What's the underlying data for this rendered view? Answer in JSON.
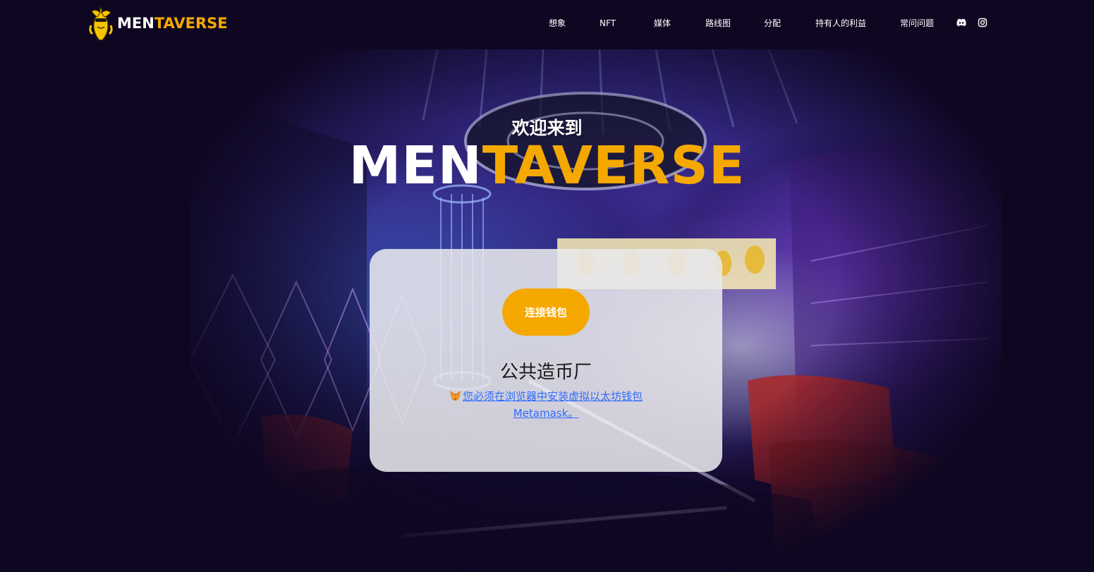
{
  "brand": {
    "logo_text_white": "MEN",
    "logo_text_yellow": "TAVERSE",
    "accent_color": "#f5a800",
    "background_color": "#0f0722"
  },
  "nav": {
    "items": [
      {
        "label": "想象"
      },
      {
        "label": "NFT"
      },
      {
        "label": "媒体"
      },
      {
        "label": "路线图"
      },
      {
        "label": "分配"
      },
      {
        "label": "持有人的利益"
      },
      {
        "label": "常问问题"
      }
    ],
    "icons": [
      "discord-icon",
      "instagram-icon"
    ]
  },
  "hero": {
    "welcome": "欢迎来到",
    "title_white": "MEN",
    "title_yellow": "TAVERSE"
  },
  "mint": {
    "connect_button": "连接钱包",
    "title": "公共造币厂",
    "metamask_notice": "您必须在浏览器中安装虚拟以太坊钱包 Metamask。",
    "link_color": "#2f6bff"
  }
}
